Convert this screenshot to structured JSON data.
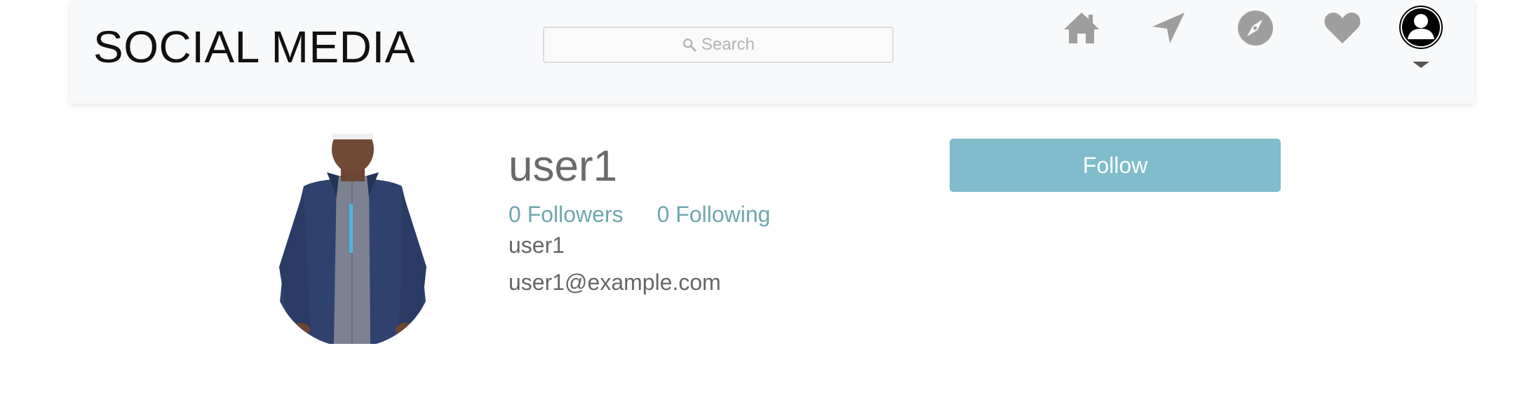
{
  "navbar": {
    "brand": "SOCIAL MEDIA",
    "search": {
      "placeholder": "Search",
      "icon": "search-icon"
    },
    "icons": [
      "home-icon",
      "send-icon",
      "explore-compass-icon",
      "heart-icon",
      "user-avatar-icon"
    ],
    "menu_caret": "chevron-down-icon"
  },
  "profile": {
    "username": "user1",
    "followers": {
      "count": "0",
      "label": "Followers"
    },
    "following": {
      "count": "0",
      "label": "Following"
    },
    "full_name": "user1",
    "email": "user1@example.com",
    "follow_label": "Follow",
    "avatar_icon": "profile-photo"
  },
  "colors": {
    "navbar_bg": "#f8f9fa",
    "accent_teal": "#6fa7ad",
    "follow_button": "#80bccb",
    "icon_gray": "#9e9e9e"
  }
}
